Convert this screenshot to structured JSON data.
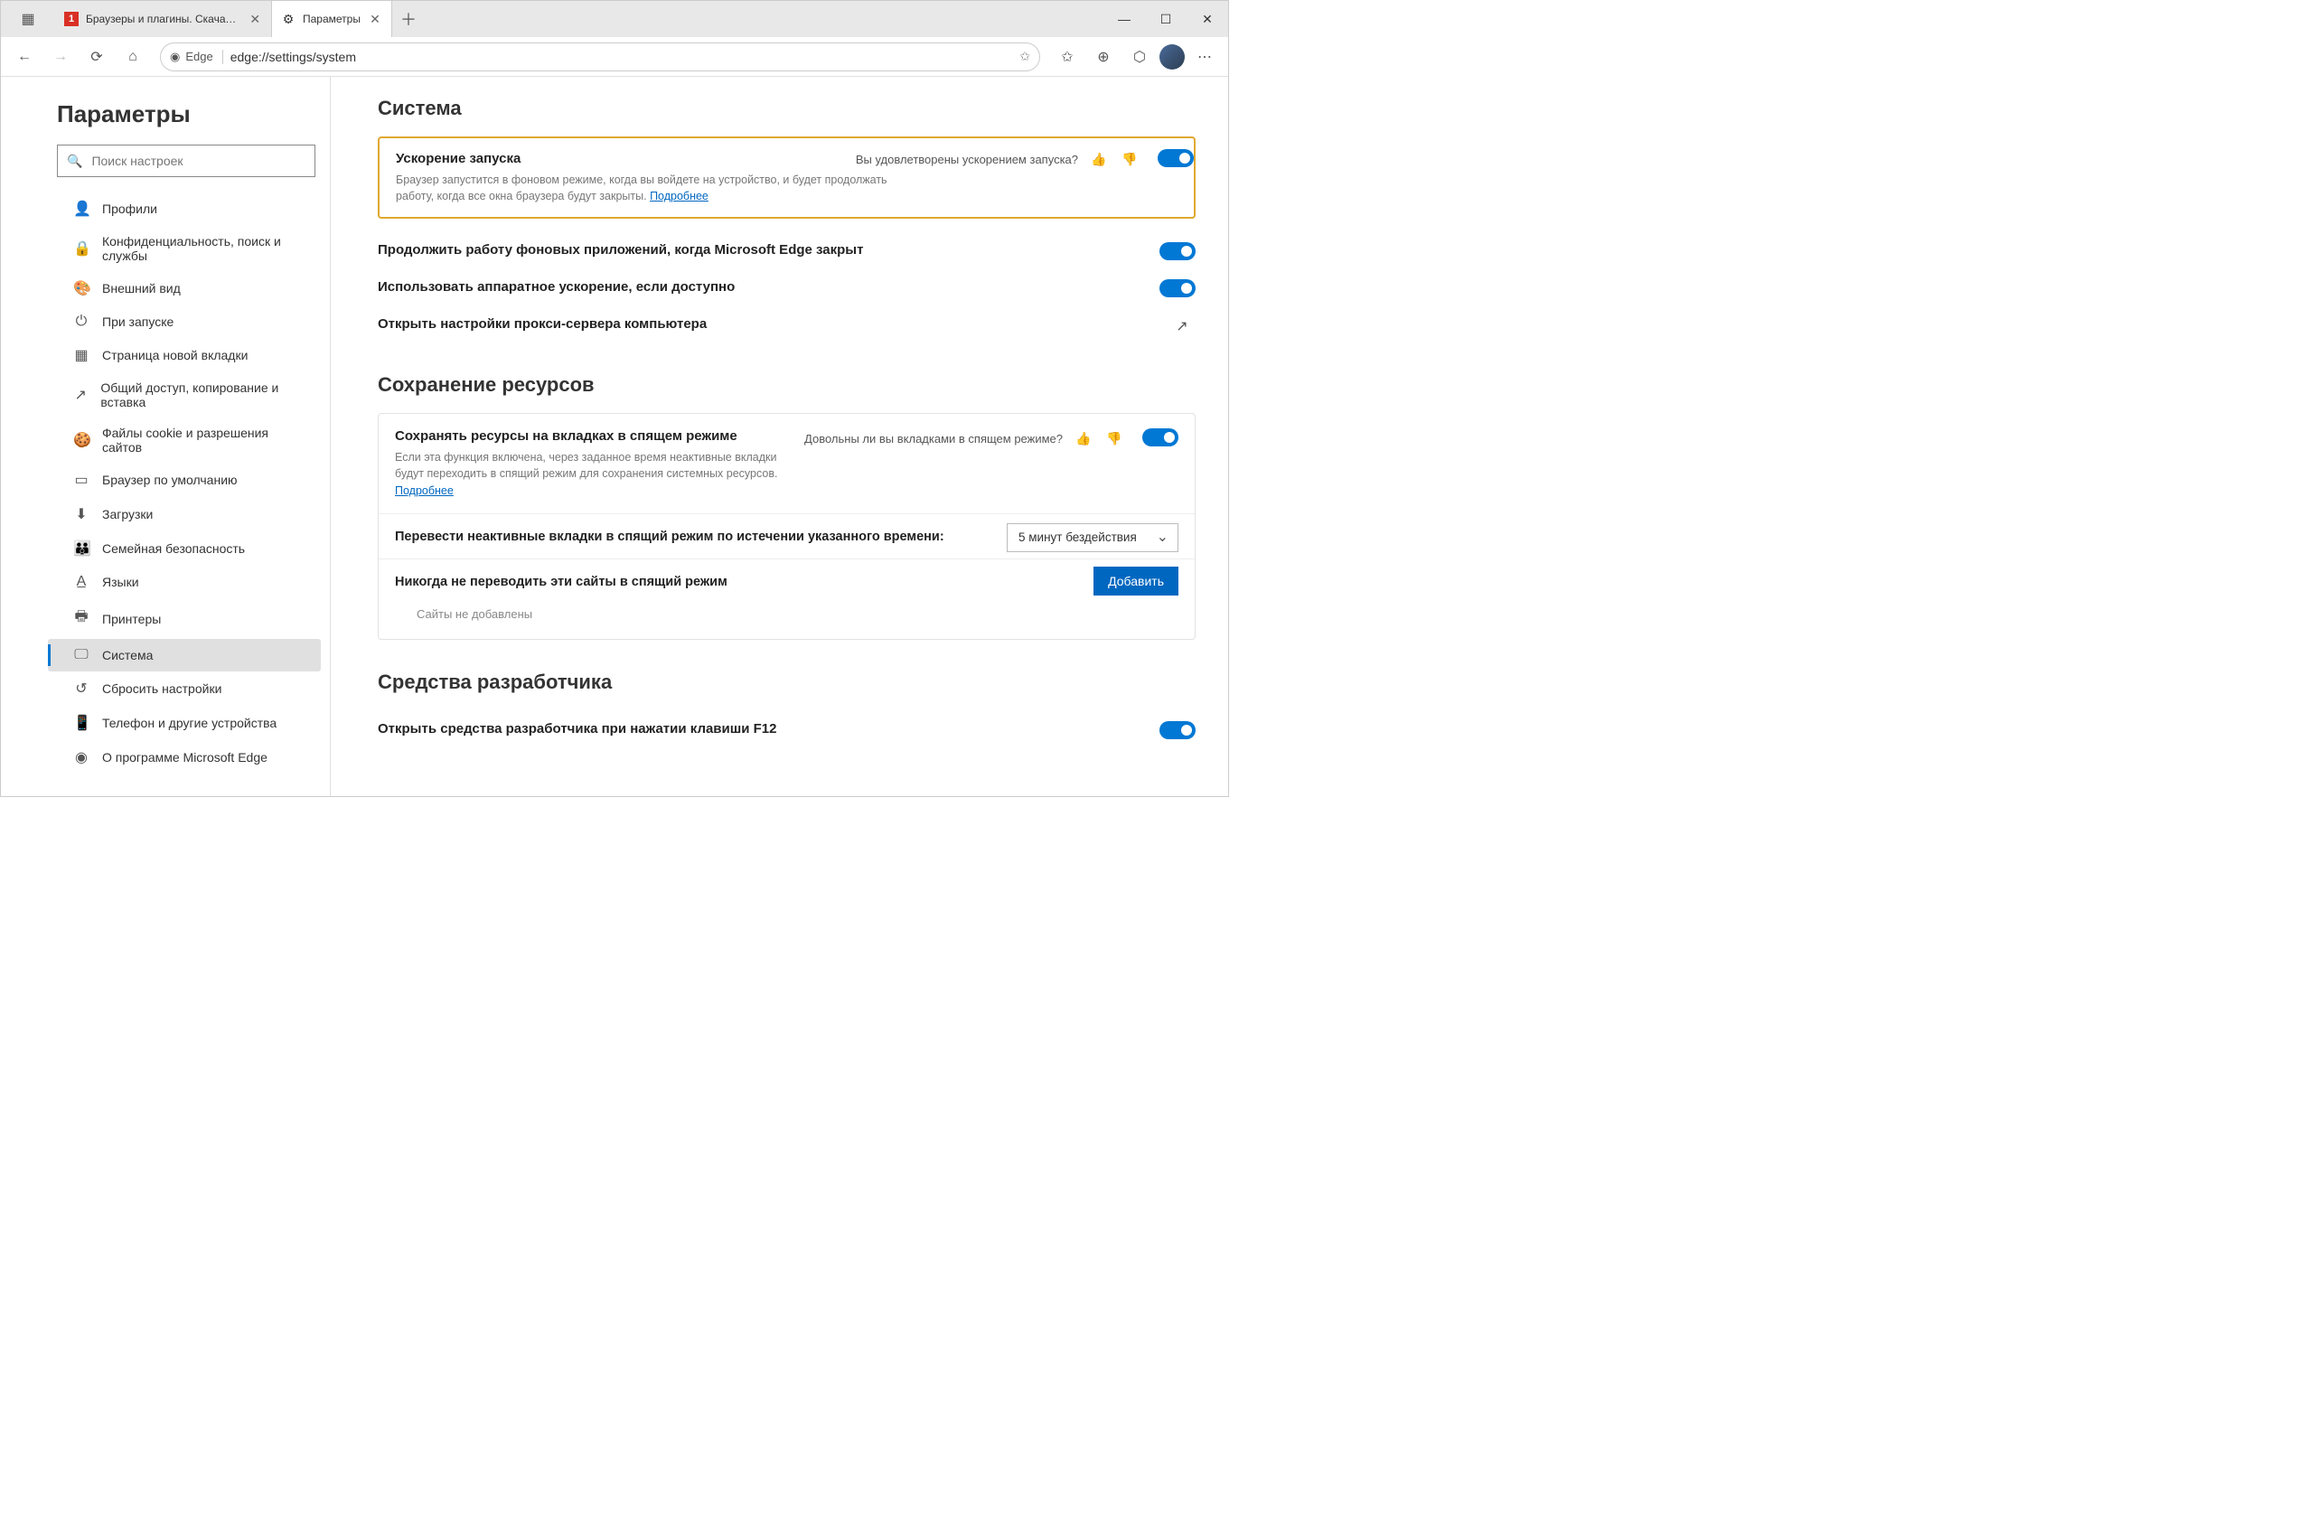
{
  "tabs": {
    "tab1": {
      "title": "Браузеры и плагины. Скачать б"
    },
    "tab2": {
      "title": "Параметры"
    }
  },
  "addressbar": {
    "browser_label": "Edge",
    "url": "edge://settings/system"
  },
  "sidebar": {
    "title": "Параметры",
    "search_placeholder": "Поиск настроек",
    "items": [
      {
        "label": "Профили"
      },
      {
        "label": "Конфиденциальность, поиск и службы"
      },
      {
        "label": "Внешний вид"
      },
      {
        "label": "При запуске"
      },
      {
        "label": "Страница новой вкладки"
      },
      {
        "label": "Общий доступ, копирование и вставка"
      },
      {
        "label": "Файлы cookie и разрешения сайтов"
      },
      {
        "label": "Браузер по умолчанию"
      },
      {
        "label": "Загрузки"
      },
      {
        "label": "Семейная безопасность"
      },
      {
        "label": "Языки"
      },
      {
        "label": "Принтеры"
      },
      {
        "label": "Система"
      },
      {
        "label": "Сбросить настройки"
      },
      {
        "label": "Телефон и другие устройства"
      },
      {
        "label": "О программе Microsoft Edge"
      }
    ]
  },
  "system": {
    "heading": "Система",
    "startup_boost": {
      "title": "Ускорение запуска",
      "desc": "Браузер запустится в фоновом режиме, когда вы войдете на устройство, и будет продолжать работу, когда все окна браузера будут закрыты. ",
      "learn_more": "Подробнее",
      "feedback_q": "Вы удовлетворены ускорением запуска?"
    },
    "continue_bg": {
      "title": "Продолжить работу фоновых приложений, когда Microsoft Edge закрыт"
    },
    "hw_accel": {
      "title": "Использовать аппаратное ускорение, если доступно"
    },
    "proxy": {
      "title": "Открыть настройки прокси-сервера компьютера"
    }
  },
  "resources": {
    "heading": "Сохранение ресурсов",
    "sleep_tabs": {
      "title": "Сохранять ресурсы на вкладках в спящем режиме",
      "desc": "Если эта функция включена, через заданное время неактивные вкладки будут переходить в спящий режим для сохранения системных ресурсов. ",
      "learn_more": "Подробнее",
      "feedback_q": "Довольны ли вы вкладками в спящем режиме?"
    },
    "timeout": {
      "label": "Перевести неактивные вкладки в спящий режим по истечении указанного времени:",
      "value": "5 минут бездействия"
    },
    "never_sleep": {
      "label": "Никогда не переводить эти сайты в спящий режим",
      "add_btn": "Добавить",
      "empty": "Сайты не добавлены"
    }
  },
  "devtools": {
    "heading": "Средства разработчика",
    "f12": {
      "title": "Открыть средства разработчика при нажатии клавиши F12"
    }
  }
}
